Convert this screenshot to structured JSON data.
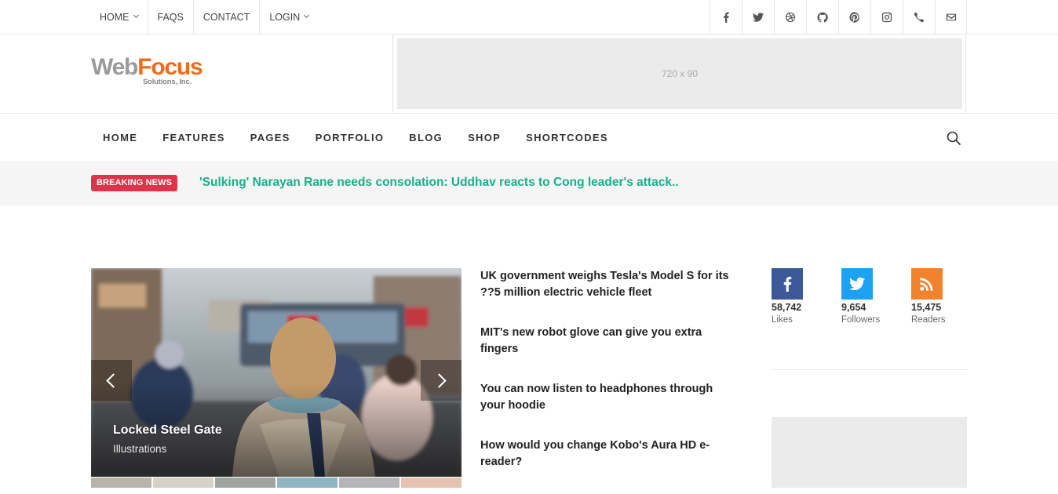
{
  "topnav": [
    {
      "label": "HOME",
      "dropdown": true
    },
    {
      "label": "FAQS",
      "dropdown": false
    },
    {
      "label": "CONTACT",
      "dropdown": false
    },
    {
      "label": "LOGIN",
      "dropdown": true
    }
  ],
  "social_icons": [
    "facebook-icon",
    "twitter-icon",
    "dribbble-icon",
    "github-icon",
    "pinterest-icon",
    "instagram-icon",
    "phone-icon",
    "mail-icon"
  ],
  "logo": {
    "part1": "Web",
    "part2": "Focus",
    "tagline": "Solutions, Inc."
  },
  "ad_banner": {
    "label": "720 x 90"
  },
  "mainnav": [
    "HOME",
    "FEATURES",
    "PAGES",
    "PORTFOLIO",
    "BLOG",
    "SHOP",
    "SHORTCODES"
  ],
  "breaking": {
    "badge": "BREAKING NEWS",
    "headline": "'Sulking' Narayan Rane needs consolation: Uddhav reacts to Cong leader's attack.."
  },
  "slider": {
    "title": "Locked Steel Gate",
    "category": "Illustrations"
  },
  "articles": [
    "UK government weighs Tesla's Model S for its ??5 million electric vehicle fleet",
    "MIT's new robot glove can give you extra fingers",
    "You can now listen to headphones through your hoodie",
    "How would you change Kobo's Aura HD e-reader?"
  ],
  "counters": [
    {
      "icon": "facebook-icon",
      "count": "58,742",
      "label": "Likes",
      "color": "#3b5998"
    },
    {
      "icon": "twitter-icon",
      "count": "9,654",
      "label": "Followers",
      "color": "#1da1f2"
    },
    {
      "icon": "rss-icon",
      "count": "15,475",
      "label": "Readers",
      "color": "#f2822e"
    }
  ],
  "colors": {
    "accent": "#1aae8a",
    "breaking": "#e0334a",
    "logo_orange": "#f26a1b"
  }
}
